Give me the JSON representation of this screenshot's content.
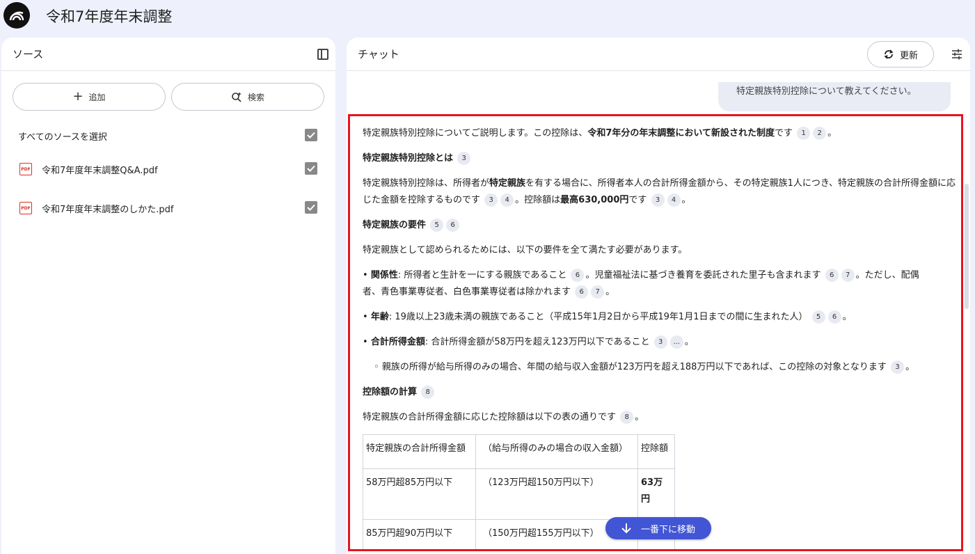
{
  "app": {
    "title": "令和7年度年末調整"
  },
  "sources": {
    "title": "ソース",
    "add_label": "追加",
    "search_label": "検索",
    "select_all_label": "すべてのソースを選択",
    "items": [
      {
        "name": "令和7年度年末調整Q&A.pdf",
        "icon": "PDF"
      },
      {
        "name": "令和7年度年末調整のしかた.pdf",
        "icon": "PDF"
      }
    ]
  },
  "chat": {
    "title": "チャット",
    "refresh_label": "更新",
    "user_message": "特定親族特別控除について教えてください。",
    "scroll_bottom_label": "一番下に移動",
    "answer": {
      "intro_a": "特定親族特別控除についてご説明します。この控除は、",
      "intro_b": "令和7年分の年末調整において新設された制度",
      "intro_c": "です",
      "h1": "特定親族特別控除とは",
      "p1_a": "特定親族特別控除は、所得者が",
      "p1_b": "特定親族",
      "p1_c": "を有する場合に、所得者本人の合計所得金額から、その特定親族1人につき、特定親族の合計所得金額に応じた金額を控除するものです",
      "p1_d": "。控除額は",
      "p1_e": "最高630,000円",
      "p1_f": "です",
      "h2": "特定親族の要件",
      "p2": "特定親族として認められるためには、以下の要件を全て満たす必要があります。",
      "b1_label": "関係性",
      "b1_a": ": 所得者と生計を一にする親族であること",
      "b1_b": "。児童福祉法に基づき養育を委託された里子も含まれます",
      "b1_c": "。ただし、配偶者、青色事業専従者、白色事業専従者は除かれます",
      "b2_label": "年齢",
      "b2_a": ": 19歳以上23歳未満の親族であること（平成15年1月2日から平成19年1月1日までの間に生まれた人）",
      "b3_label": "合計所得金額",
      "b3_a": ": 合計所得金額が58万円を超え123万円以下であること",
      "sub1": "親族の所得が給与所得のみの場合、年間の給与収入金額が123万円を超え188万円以下であれば、この控除の対象となります",
      "h3": "控除額の計算",
      "p3": "特定親族の合計所得金額に応じた控除額は以下の表の通りです",
      "period": "。",
      "bullet": "•",
      "sub_bullet": "◦",
      "cites": {
        "c1": "1",
        "c2": "2",
        "c3": "3",
        "c4": "4",
        "c5": "5",
        "c6": "6",
        "c7": "7",
        "c8": "8",
        "more": "..."
      },
      "table": {
        "headers": [
          "特定親族の合計所得金額",
          "（給与所得のみの場合の収入金額）",
          "控除額"
        ],
        "rows": [
          [
            "58万円超85万円以下",
            "（123万円超150万円以下）",
            "63万円"
          ],
          [
            "85万円超90万円以下",
            "（150万円超155万円以下）",
            ""
          ]
        ]
      }
    }
  }
}
